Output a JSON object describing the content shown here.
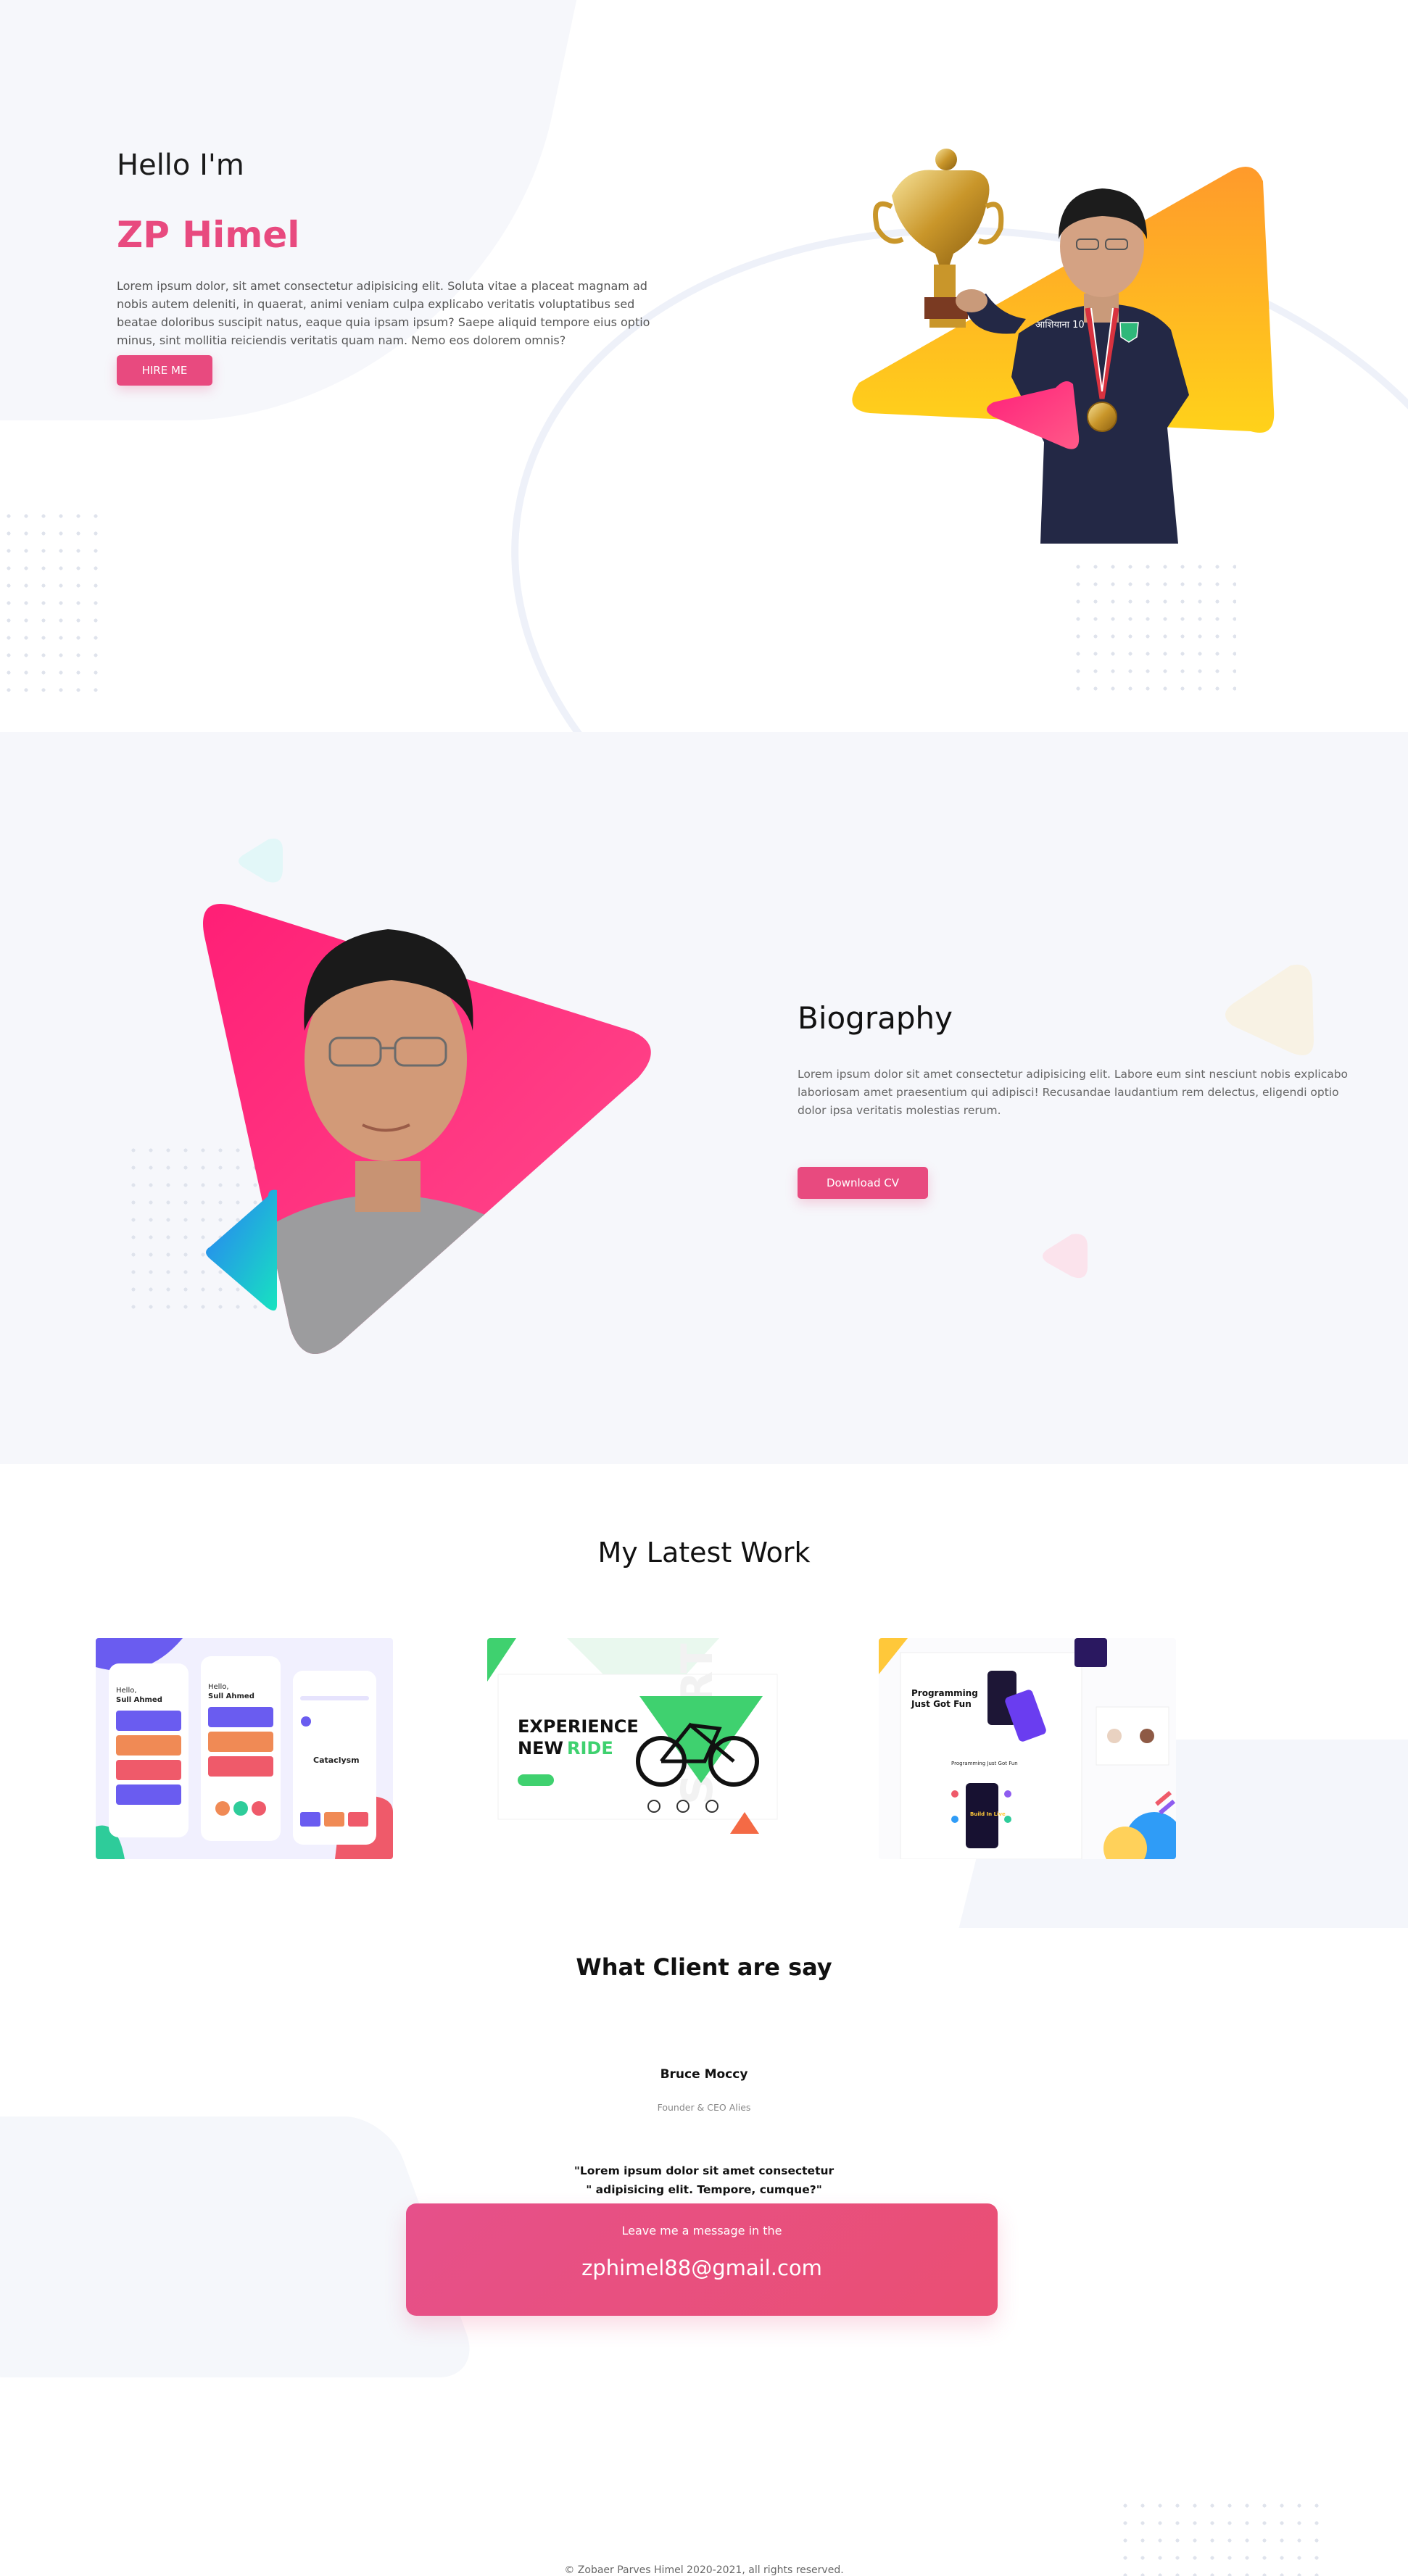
{
  "hero": {
    "greeting": "Hello I'm",
    "name": "ZP Himel",
    "description": "Lorem ipsum dolor, sit amet consectetur adipisicing elit. Soluta vitae a placeat magnam ad nobis autem deleniti, in quaerat, animi veniam culpa explicabo veritatis voluptatibus sed beatae doloribus suscipit natus, eaque quia ipsam ipsum? Saepe aliquid tempore eius optio minus, sint mollitia reiciendis veritatis quam nam. Nemo eos dolorem omnis?",
    "hire_button": "HIRE ME",
    "jersey_text": "आशियाना 10"
  },
  "biography": {
    "title": "Biography",
    "description": "Lorem ipsum dolor sit amet consectetur adipisicing elit. Labore eum sint nesciunt nobis explicabo laboriosam amet praesentium qui adipisci! Recusandae laudantium rem delectus, eligendi optio dolor ipsa veritatis molestias rerum.",
    "cv_button": "Download CV"
  },
  "work": {
    "title": "My Latest Work",
    "projects": [
      {
        "greeting": "Hello,",
        "subtitle": "Sull Ahmed",
        "center_word": "Cataclysm"
      },
      {
        "headline_1": "EXPERIENCE",
        "headline_2": "NEW",
        "headline_accent": "RIDE",
        "bg_word": "SPORT"
      },
      {
        "headline_1": "Programming",
        "headline_2": "Just Got Fun",
        "center_label": "Programming Just Got Fun",
        "phone_word": "Build In Live"
      }
    ]
  },
  "testimonials": {
    "title": "What Client are say",
    "client_name": "Bruce Moccy",
    "client_role": "Founder & CEO Alies",
    "quote_line1": "\"Lorem ipsum dolor sit amet consectetur",
    "quote_line2": "\" adipisicing elit. Tempore, cumque?\""
  },
  "contact": {
    "label": "Leave me a message in the",
    "email": "zphimel88@gmail.com"
  },
  "footer": {
    "copyright": "© Zobaer Parves Himel 2020-2021, all rights reserved."
  },
  "colors": {
    "accent": "#e84a7f",
    "hero_triangle_top": "#ff9a2b",
    "hero_triangle_bottom": "#ffd21a",
    "bio_triangle": "#ff2f7d",
    "teal": "#17e3c0",
    "section_bg": "#f6f7fb"
  }
}
